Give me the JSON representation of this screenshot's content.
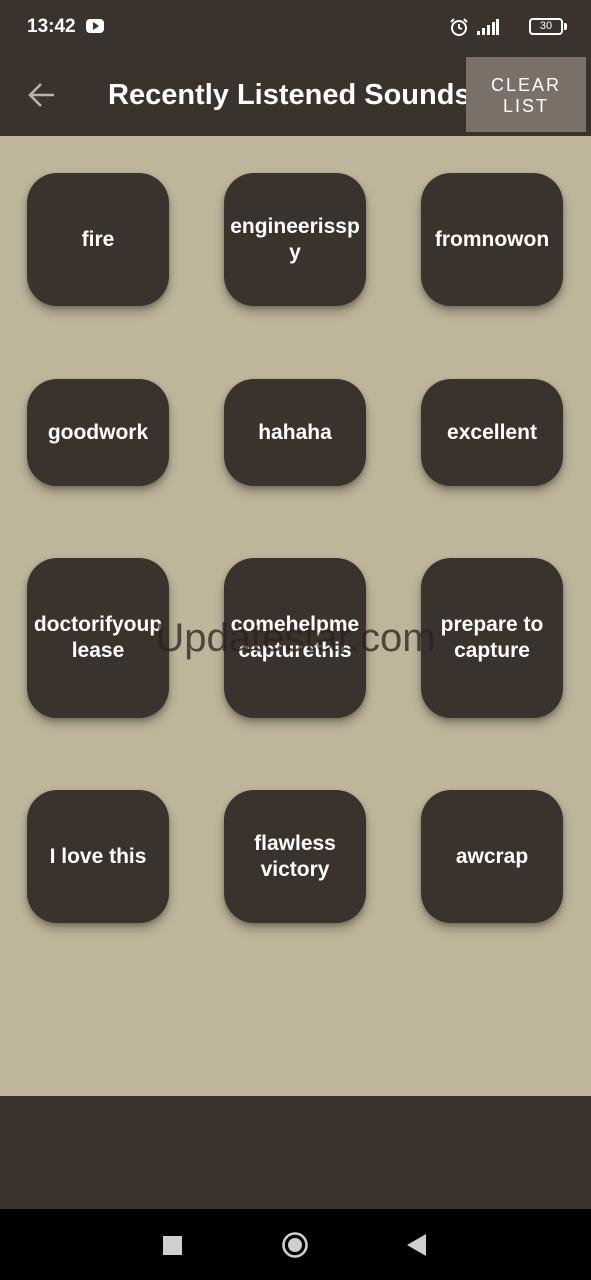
{
  "status_bar": {
    "time": "13:42",
    "battery": "30",
    "icons": [
      "youtube-icon",
      "alarm-icon",
      "signal-icon",
      "battery-icon"
    ]
  },
  "app_bar": {
    "title": "Recently Listened Sounds",
    "clear_button": "CLEAR LIST",
    "back_icon": "arrow-left-icon"
  },
  "sounds": [
    "fire",
    "engineerisspy",
    "fromnowon",
    "goodwork",
    "hahaha",
    "excellent",
    "doctorifyouplease",
    "comehelpmecapturethis",
    "prepare to capture",
    "I love this",
    "flawless victory",
    "awcrap"
  ],
  "watermark": "Updatestar.com",
  "nav_bar": [
    "recents-icon",
    "home-icon",
    "back-icon"
  ],
  "colors": {
    "background": "#bfb59b",
    "bar": "#3a332d",
    "tile": "#3a332d",
    "clear_button": "#7b7068",
    "text": "#ffffff"
  }
}
